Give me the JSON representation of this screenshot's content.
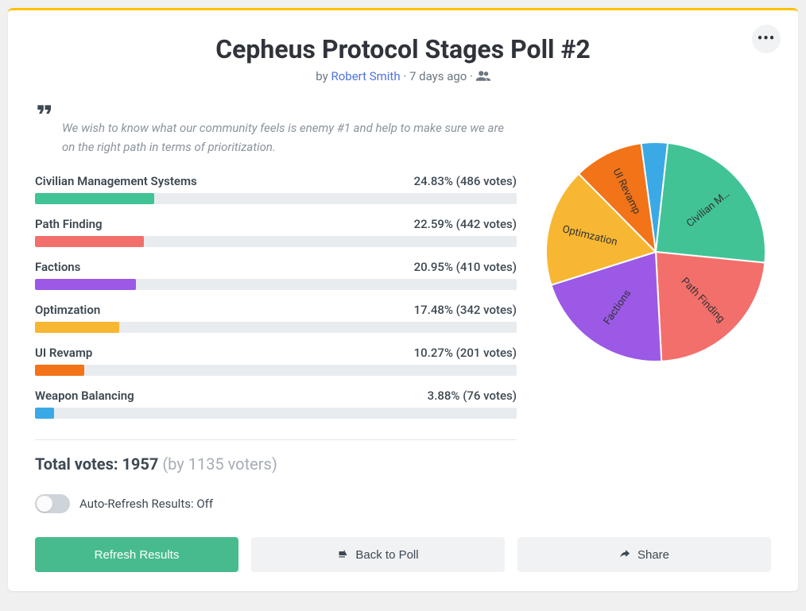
{
  "header": {
    "title": "Cepheus Protocol Stages Poll #2",
    "by_text": "by",
    "author": "Robert Smith",
    "sep": " · ",
    "age": "7 days ago"
  },
  "quote": "We wish to know what our community feels is enemy #1 and help to make sure we are on the right path in terms of prioritization.",
  "options": [
    {
      "label": "Civilian Management Systems",
      "pct": "24.83%",
      "votes_txt": "(486 votes)",
      "pct_num": 24.83,
      "votes": 486,
      "color": "#41c396",
      "pie_label": "Civilian M…"
    },
    {
      "label": "Path Finding",
      "pct": "22.59%",
      "votes_txt": "(442 votes)",
      "pct_num": 22.59,
      "votes": 442,
      "color": "#f36f6b",
      "pie_label": "Path Finding"
    },
    {
      "label": "Factions",
      "pct": "20.95%",
      "votes_txt": "(410 votes)",
      "pct_num": 20.95,
      "votes": 410,
      "color": "#9b59e6",
      "pie_label": "Factions"
    },
    {
      "label": "Optimzation",
      "pct": "17.48%",
      "votes_txt": "(342 votes)",
      "pct_num": 17.48,
      "votes": 342,
      "color": "#f7b733",
      "pie_label": "Optimzation"
    },
    {
      "label": "UI Revamp",
      "pct": "10.27%",
      "votes_txt": "(201 votes)",
      "pct_num": 10.27,
      "votes": 201,
      "color": "#f27318",
      "pie_label": "UI Revamp"
    },
    {
      "label": "Weapon Balancing",
      "pct": "3.88%",
      "votes_txt": "(76 votes)",
      "pct_num": 3.88,
      "votes": 76,
      "color": "#3ba9e6",
      "pie_label": ""
    }
  ],
  "totals": {
    "prefix": "Total votes: ",
    "votes": "1957",
    "voters": " (by 1135 voters)"
  },
  "auto_refresh_label": "Auto-Refresh Results: Off",
  "buttons": {
    "refresh": "Refresh Results",
    "back": "Back to Poll",
    "share": "Share"
  },
  "chart_data": {
    "type": "pie",
    "title": "Cepheus Protocol Stages Poll #2",
    "categories": [
      "Civilian Management Systems",
      "Path Finding",
      "Factions",
      "Optimzation",
      "UI Revamp",
      "Weapon Balancing"
    ],
    "values": [
      486,
      442,
      410,
      342,
      201,
      76
    ],
    "percentages": [
      24.83,
      22.59,
      20.95,
      17.48,
      10.27,
      3.88
    ],
    "colors": [
      "#41c396",
      "#f36f6b",
      "#9b59e6",
      "#f7b733",
      "#f27318",
      "#3ba9e6"
    ],
    "total_votes": 1957,
    "total_voters": 1135
  }
}
